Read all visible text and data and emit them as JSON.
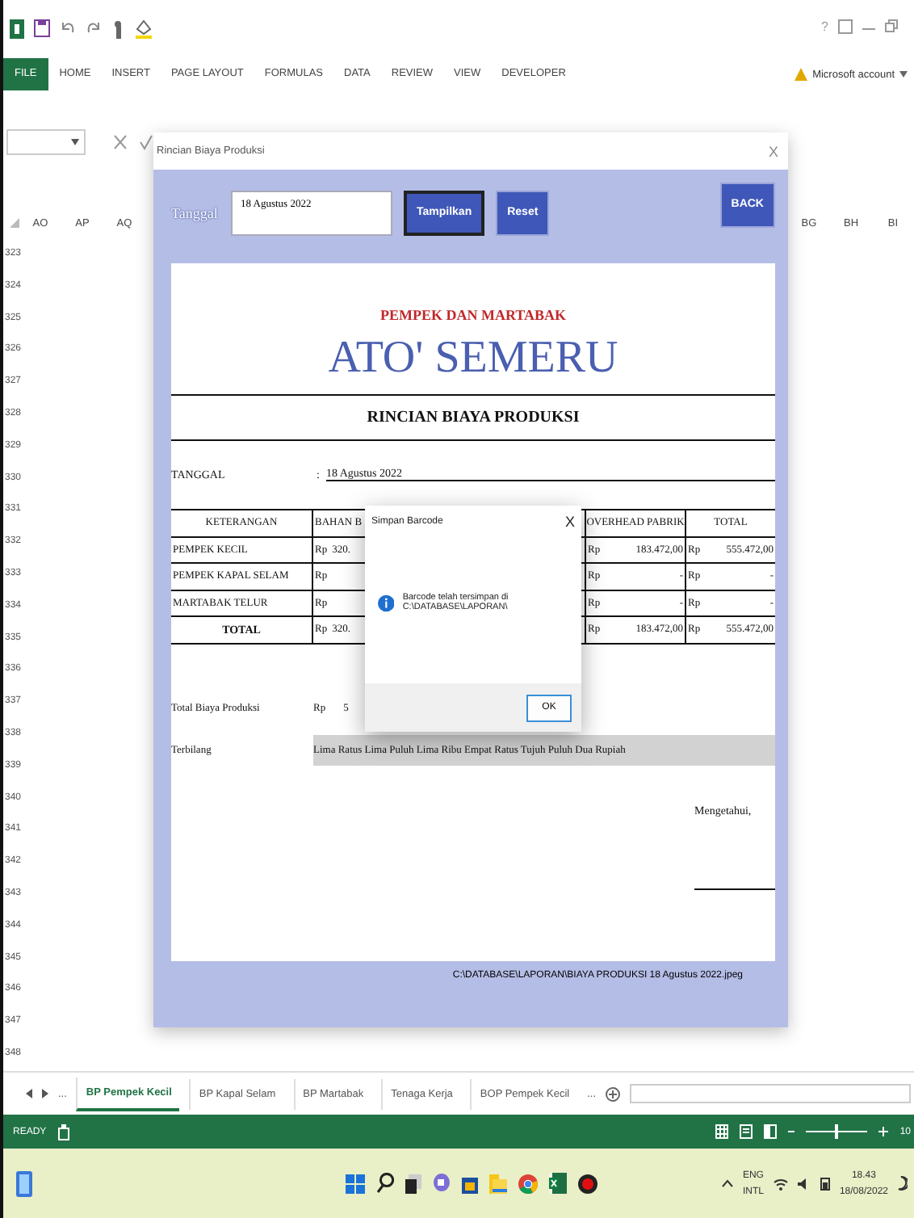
{
  "excel": {
    "help": "?",
    "ribbon_tabs": [
      {
        "label": "FILE",
        "selected": true
      },
      {
        "label": "HOME",
        "selected": false
      },
      {
        "label": "INSERT",
        "selected": false
      },
      {
        "label": "PAGE LAYOUT",
        "selected": false
      },
      {
        "label": "FORMULAS",
        "selected": false
      },
      {
        "label": "DATA",
        "selected": false
      },
      {
        "label": "REVIEW",
        "selected": false
      },
      {
        "label": "VIEW",
        "selected": false
      },
      {
        "label": "DEVELOPER",
        "selected": false
      }
    ],
    "account": "Microsoft account",
    "columns_left": [
      "AO",
      "AP",
      "AQ"
    ],
    "columns_right": [
      "BG",
      "BH",
      "BI"
    ],
    "rows": [
      "323",
      "324",
      "325",
      "326",
      "327",
      "328",
      "329",
      "330",
      "331",
      "332",
      "333",
      "334",
      "335",
      "336",
      "337",
      "338",
      "339",
      "340",
      "341",
      "342",
      "343",
      "344",
      "345",
      "346",
      "347",
      "348"
    ],
    "sheet_tabs_more": "...",
    "sheet_tabs": [
      {
        "label": "BP Pempek Kecil",
        "selected": true
      },
      {
        "label": "BP Kapal Selam",
        "selected": false
      },
      {
        "label": "BP Martabak",
        "selected": false
      },
      {
        "label": "Tenaga Kerja",
        "selected": false
      },
      {
        "label": "BOP Pempek Kecil",
        "selected": false
      }
    ],
    "sheet_tabs_more_right": "...",
    "status": "READY",
    "zoom_slider": {
      "level": 0.5
    },
    "zoom": "10"
  },
  "form": {
    "title": "Rincian Biaya Produksi",
    "close": "X",
    "date_label": "Tanggal",
    "date_value": "18 Agustus 2022",
    "buttons": [
      {
        "label": "Tampilkan",
        "focused": true
      },
      {
        "label": "Reset",
        "focused": false
      }
    ],
    "back": "BACK",
    "report": {
      "subtitle": "PEMPEK DAN MARTABAK",
      "name": "ATO' SEMERU",
      "title": "RINCIAN BIAYA PRODUKSI",
      "date_label": "TANGGAL",
      "date_colon": ":",
      "date_value": "18 Agustus 2022",
      "columns": [
        "KETERANGAN",
        "BAHAN B",
        "OVERHEAD PABRIK",
        "TOTAL"
      ],
      "rows": [
        {
          "kind": "item",
          "cells": [
            {
              "text": "PEMPEK KECIL"
            },
            {
              "cur": "Rp",
              "value": "320."
            },
            {
              "cur": "Rp",
              "value": "183.472,00"
            },
            {
              "cur": "Rp",
              "value": "555.472,00"
            }
          ]
        },
        {
          "kind": "item",
          "cells": [
            {
              "text": "PEMPEK KAPAL SELAM"
            },
            {
              "cur": "Rp"
            },
            {
              "cur": "Rp",
              "value": "-"
            },
            {
              "cur": "Rp",
              "value": "-"
            }
          ]
        },
        {
          "kind": "item",
          "cells": [
            {
              "text": "MARTABAK TELUR"
            },
            {
              "cur": "Rp"
            },
            {
              "cur": "Rp",
              "value": "-"
            },
            {
              "cur": "Rp",
              "value": "-"
            }
          ]
        },
        {
          "kind": "total",
          "cells": [
            {
              "text": "TOTAL"
            },
            {
              "cur": "Rp",
              "value": "320."
            },
            {
              "cur": "Rp",
              "value": "183.472,00"
            },
            {
              "cur": "Rp",
              "value": "555.472,00"
            }
          ]
        }
      ],
      "total_label": "Total Biaya Produksi",
      "total_cur": "Rp",
      "total_value": "5",
      "words_label": "Terbilang",
      "words": "Lima Ratus Lima Puluh Lima Ribu Empat Ratus Tujuh Puluh Dua Rupiah",
      "acknowledged": "Mengetahui,"
    },
    "saved_path": "C:\\DATABASE\\LAPORAN\\BIAYA PRODUKSI 18 Agustus 2022.jpeg"
  },
  "dialog": {
    "title": "Simpan Barcode",
    "close": "X",
    "message": "Barcode telah tersimpan di C:\\DATABASE\\LAPORAN\\",
    "ok": "OK"
  },
  "taskbar": {
    "lang": "ENG",
    "layout": "INTL",
    "time": "18.43",
    "date": "18/08/2022"
  }
}
